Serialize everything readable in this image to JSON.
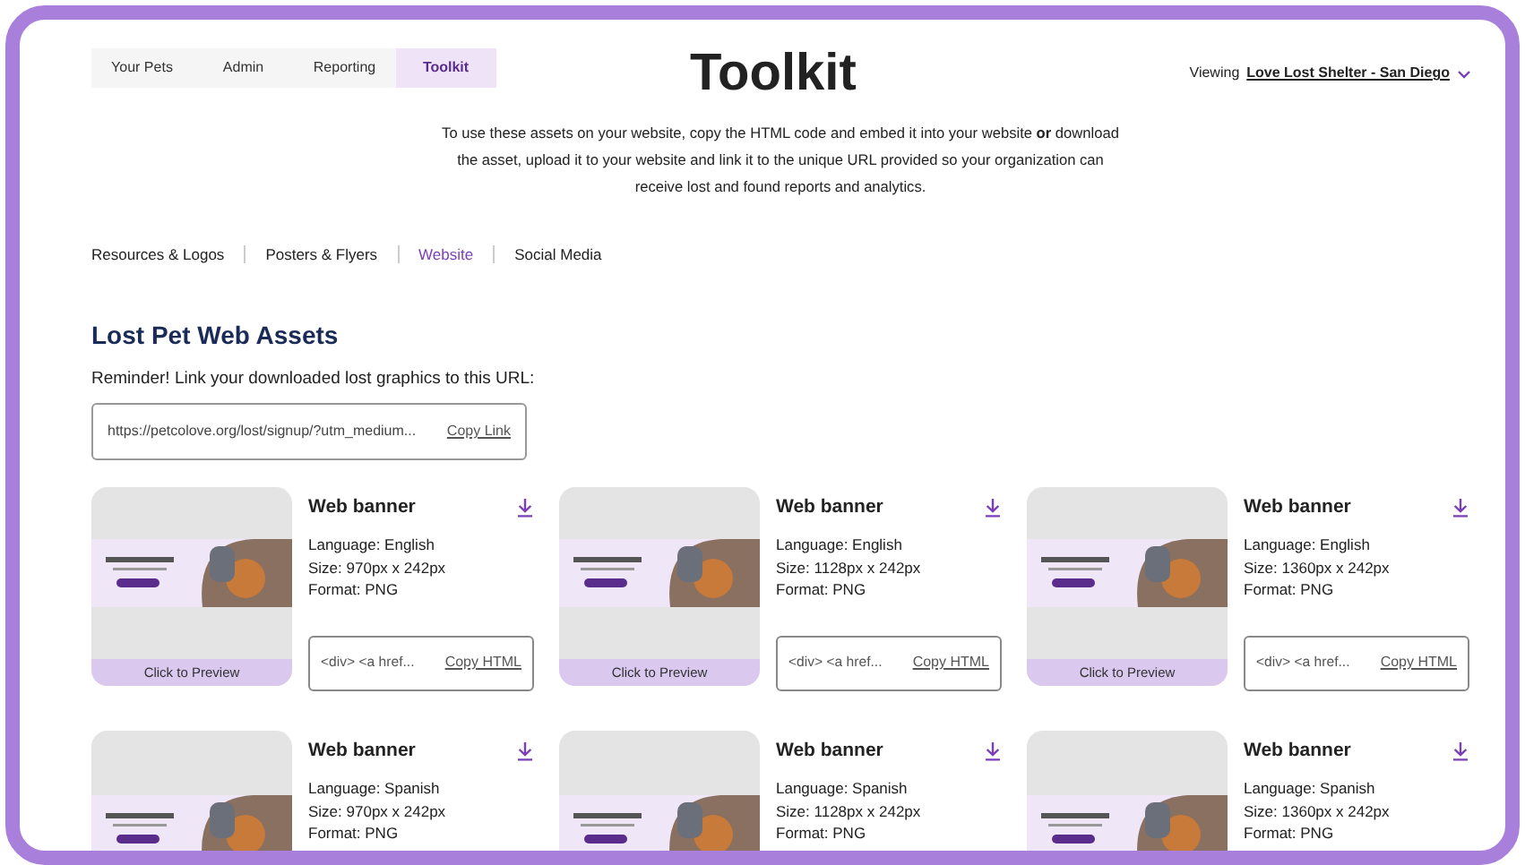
{
  "nav_tabs": [
    {
      "label": "Your Pets",
      "selected": false
    },
    {
      "label": "Admin",
      "selected": false
    },
    {
      "label": "Reporting",
      "selected": false
    },
    {
      "label": "Toolkit",
      "selected": true
    }
  ],
  "page_title": "Toolkit",
  "viewing": {
    "label": "Viewing",
    "organization": "Love Lost Shelter - San Diego"
  },
  "intro": "To use these assets on your website, copy the HTML code and embed it into your website **or** download the asset, upload it to your website and link it to the unique URL provided so your organization can receive lost and found reports and analytics.",
  "sub_tabs": [
    {
      "label": "Resources & Logos",
      "selected": false
    },
    {
      "label": "Posters & Flyers",
      "selected": false
    },
    {
      "label": "Website",
      "selected": true
    },
    {
      "label": "Social Media",
      "selected": false
    }
  ],
  "section_title": "Lost Pet Web Assets",
  "reminder": "Reminder! Link your downloaded lost graphics to this URL:",
  "url_field": {
    "value": "https://petcolove.org/lost/signup/?utm_medium...",
    "action": "Copy Link"
  },
  "assets": [
    {
      "title": "Web banner",
      "language": "Language: English",
      "size": "Size: 970px x 242px",
      "format": "Format: PNG",
      "html": "<div> <a href...",
      "copy": "Copy HTML",
      "preview": "Click to Preview"
    },
    {
      "title": "Web banner",
      "language": "Language: English",
      "size": "Size: 1128px x 242px",
      "format": "Format: PNG",
      "html": "<div> <a href...",
      "copy": "Copy HTML",
      "preview": "Click to Preview"
    },
    {
      "title": "Web banner",
      "language": "Language: English",
      "size": "Size: 1360px x 242px",
      "format": "Format: PNG",
      "html": "<div> <a href...",
      "copy": "Copy HTML",
      "preview": "Click to Preview"
    },
    {
      "title": "Web banner",
      "language": "Language: Spanish",
      "size": "Size: 970px x 242px",
      "format": "Format: PNG"
    },
    {
      "title": "Web banner",
      "language": "Language: Spanish",
      "size": "Size: 1128px x 242px",
      "format": "Format: PNG"
    },
    {
      "title": "Web banner",
      "language": "Language: Spanish",
      "size": "Size: 1360px x 242px",
      "format": "Format: PNG"
    }
  ]
}
